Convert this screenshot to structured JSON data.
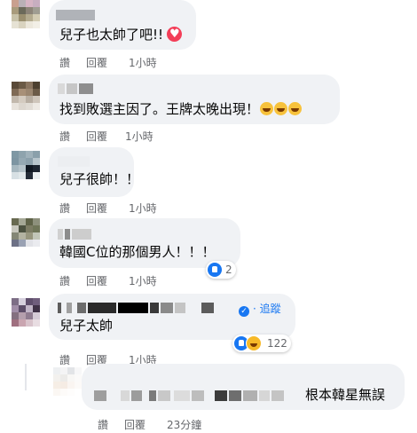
{
  "comments": [
    {
      "text": "兒子也太帥了吧!!",
      "actions": {
        "like": "讚",
        "reply": "回覆",
        "time": "1小時"
      }
    },
    {
      "text": "找到敗選主因了。王牌太晚出現！",
      "actions": {
        "like": "讚",
        "reply": "回覆",
        "time": "1小時"
      }
    },
    {
      "text": "兒子很帥！！",
      "actions": {
        "like": "讚",
        "reply": "回覆",
        "time": "1小時"
      }
    },
    {
      "text": "韓國C位的那個男人！！！",
      "reaction_count": "2",
      "actions": {
        "like": "讚",
        "reply": "回覆",
        "time": "1小時"
      }
    },
    {
      "text": "兒子太帥",
      "follow_label": "· 追蹤",
      "reaction_count": "122",
      "actions": {
        "like": "讚",
        "reply": "回覆",
        "time": "1小時"
      }
    }
  ],
  "reply": {
    "text": "根本韓星無誤",
    "actions": {
      "like": "讚",
      "reply": "回覆",
      "time": "23分鐘"
    }
  },
  "colors": {
    "bubble": "#f0f2f5",
    "action_text": "#65676b",
    "link": "#1877f2",
    "like": "#1877f2",
    "love": "#f33e58",
    "haha": "#f7b928"
  },
  "icons": [
    "heart-icon",
    "laugh-emoji-icon",
    "like-icon",
    "haha-icon",
    "verified-icon"
  ]
}
